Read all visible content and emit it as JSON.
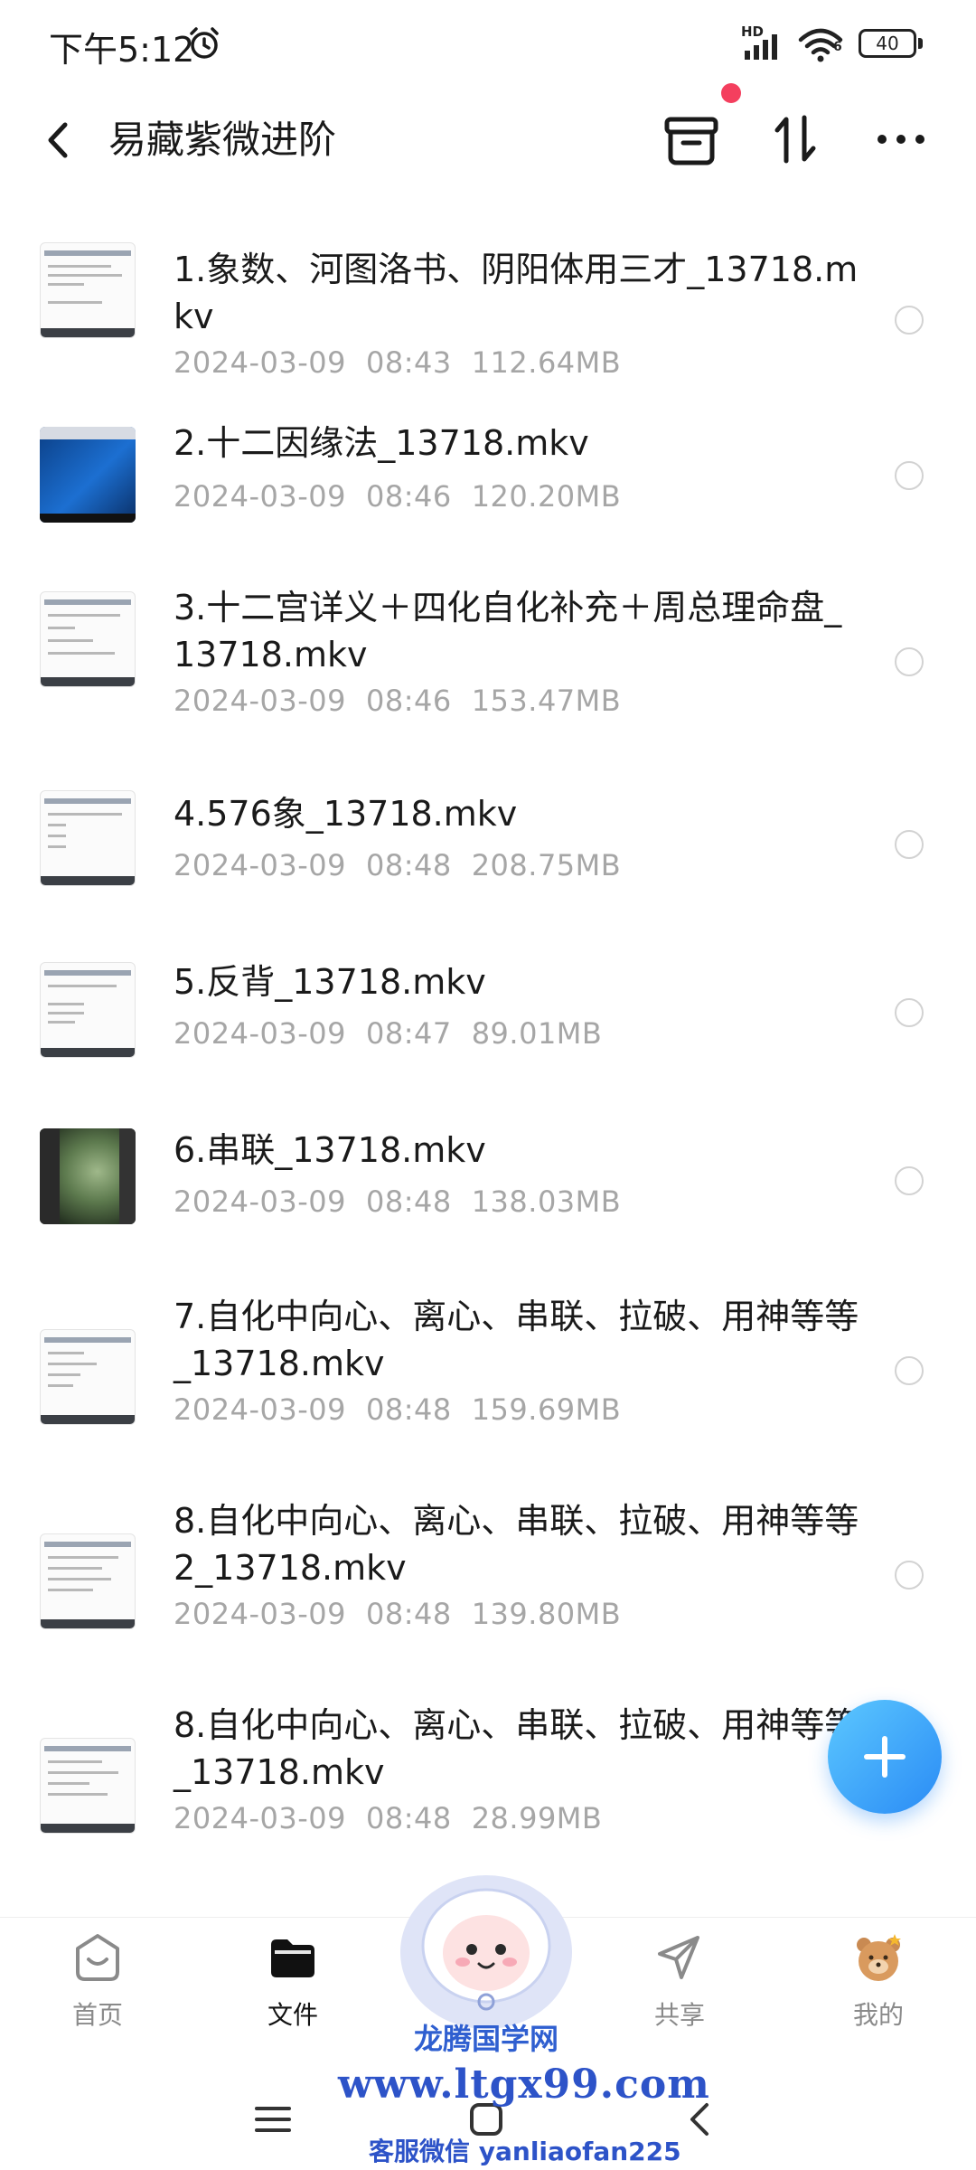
{
  "status_bar": {
    "time": "下午5:12",
    "network_label": "HD",
    "wifi_label": "6",
    "battery": "40"
  },
  "header": {
    "title": "易藏紫微进阶"
  },
  "files": [
    {
      "name": "1.象数、河图洛书、阴阳体用三才_13718.mkv",
      "date": "2024-03-09",
      "time": "08:43",
      "size": "112.64MB"
    },
    {
      "name": "2.十二因缘法_13718.mkv",
      "date": "2024-03-09",
      "time": "08:46",
      "size": "120.20MB"
    },
    {
      "name": "3.十二宫详义＋四化自化补充＋周总理命盘_13718.mkv",
      "date": "2024-03-09",
      "time": "08:46",
      "size": "153.47MB"
    },
    {
      "name": "4.576象_13718.mkv",
      "date": "2024-03-09",
      "time": "08:48",
      "size": "208.75MB"
    },
    {
      "name": "5.反背_13718.mkv",
      "date": "2024-03-09",
      "time": "08:47",
      "size": "89.01MB"
    },
    {
      "name": "6.串联_13718.mkv",
      "date": "2024-03-09",
      "time": "08:48",
      "size": "138.03MB"
    },
    {
      "name": "7.自化中向心、离心、串联、拉破、用神等等_13718.mkv",
      "date": "2024-03-09",
      "time": "08:48",
      "size": "159.69MB"
    },
    {
      "name": "8.自化中向心、离心、串联、拉破、用神等等2_13718.mkv",
      "date": "2024-03-09",
      "time": "08:48",
      "size": "139.80MB"
    },
    {
      "name": "8.自化中向心、离心、串联、拉破、用神等等_13718.mkv",
      "date": "2024-03-09",
      "time": "08:48",
      "size": "28.99MB"
    }
  ],
  "bottom_nav": {
    "home": "首页",
    "files": "文件",
    "share": "共享",
    "mine": "我的"
  },
  "watermark": {
    "line1": "龙腾国学网",
    "line2": "www.ltgx99.com",
    "line3": "客服微信 yanliaofan225"
  },
  "colors": {
    "accent": "#2a8bf5",
    "notify_dot": "#f43f5e",
    "meta_text": "#a6a6a6"
  }
}
